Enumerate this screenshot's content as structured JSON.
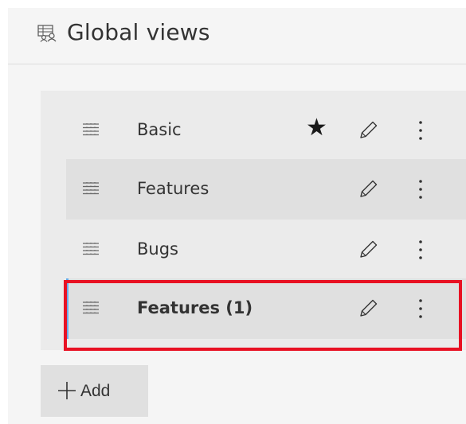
{
  "header": {
    "title": "Global views",
    "icon": "views-icon"
  },
  "views": [
    {
      "label": "Basic",
      "favorite": true,
      "selected": false,
      "bold": false
    },
    {
      "label": "Features",
      "favorite": false,
      "selected": false,
      "bold": false
    },
    {
      "label": "Bugs",
      "favorite": false,
      "selected": false,
      "bold": false
    },
    {
      "label": "Features (1)",
      "favorite": false,
      "selected": true,
      "bold": true
    }
  ],
  "row_icons": {
    "view": "grid-list-icon",
    "favorite": "star-icon",
    "edit": "pencil-icon",
    "more": "more-vertical-icon"
  },
  "add_button": {
    "label": "Add",
    "icon": "plus-icon"
  },
  "colors": {
    "accent": "#6aa9e9",
    "highlight_border": "#e81123",
    "panel_bg": "#f5f5f5",
    "list_bg": "#ebebeb",
    "row_alt_bg": "#e0e0e0"
  },
  "glyphs": {
    "star": "★"
  }
}
